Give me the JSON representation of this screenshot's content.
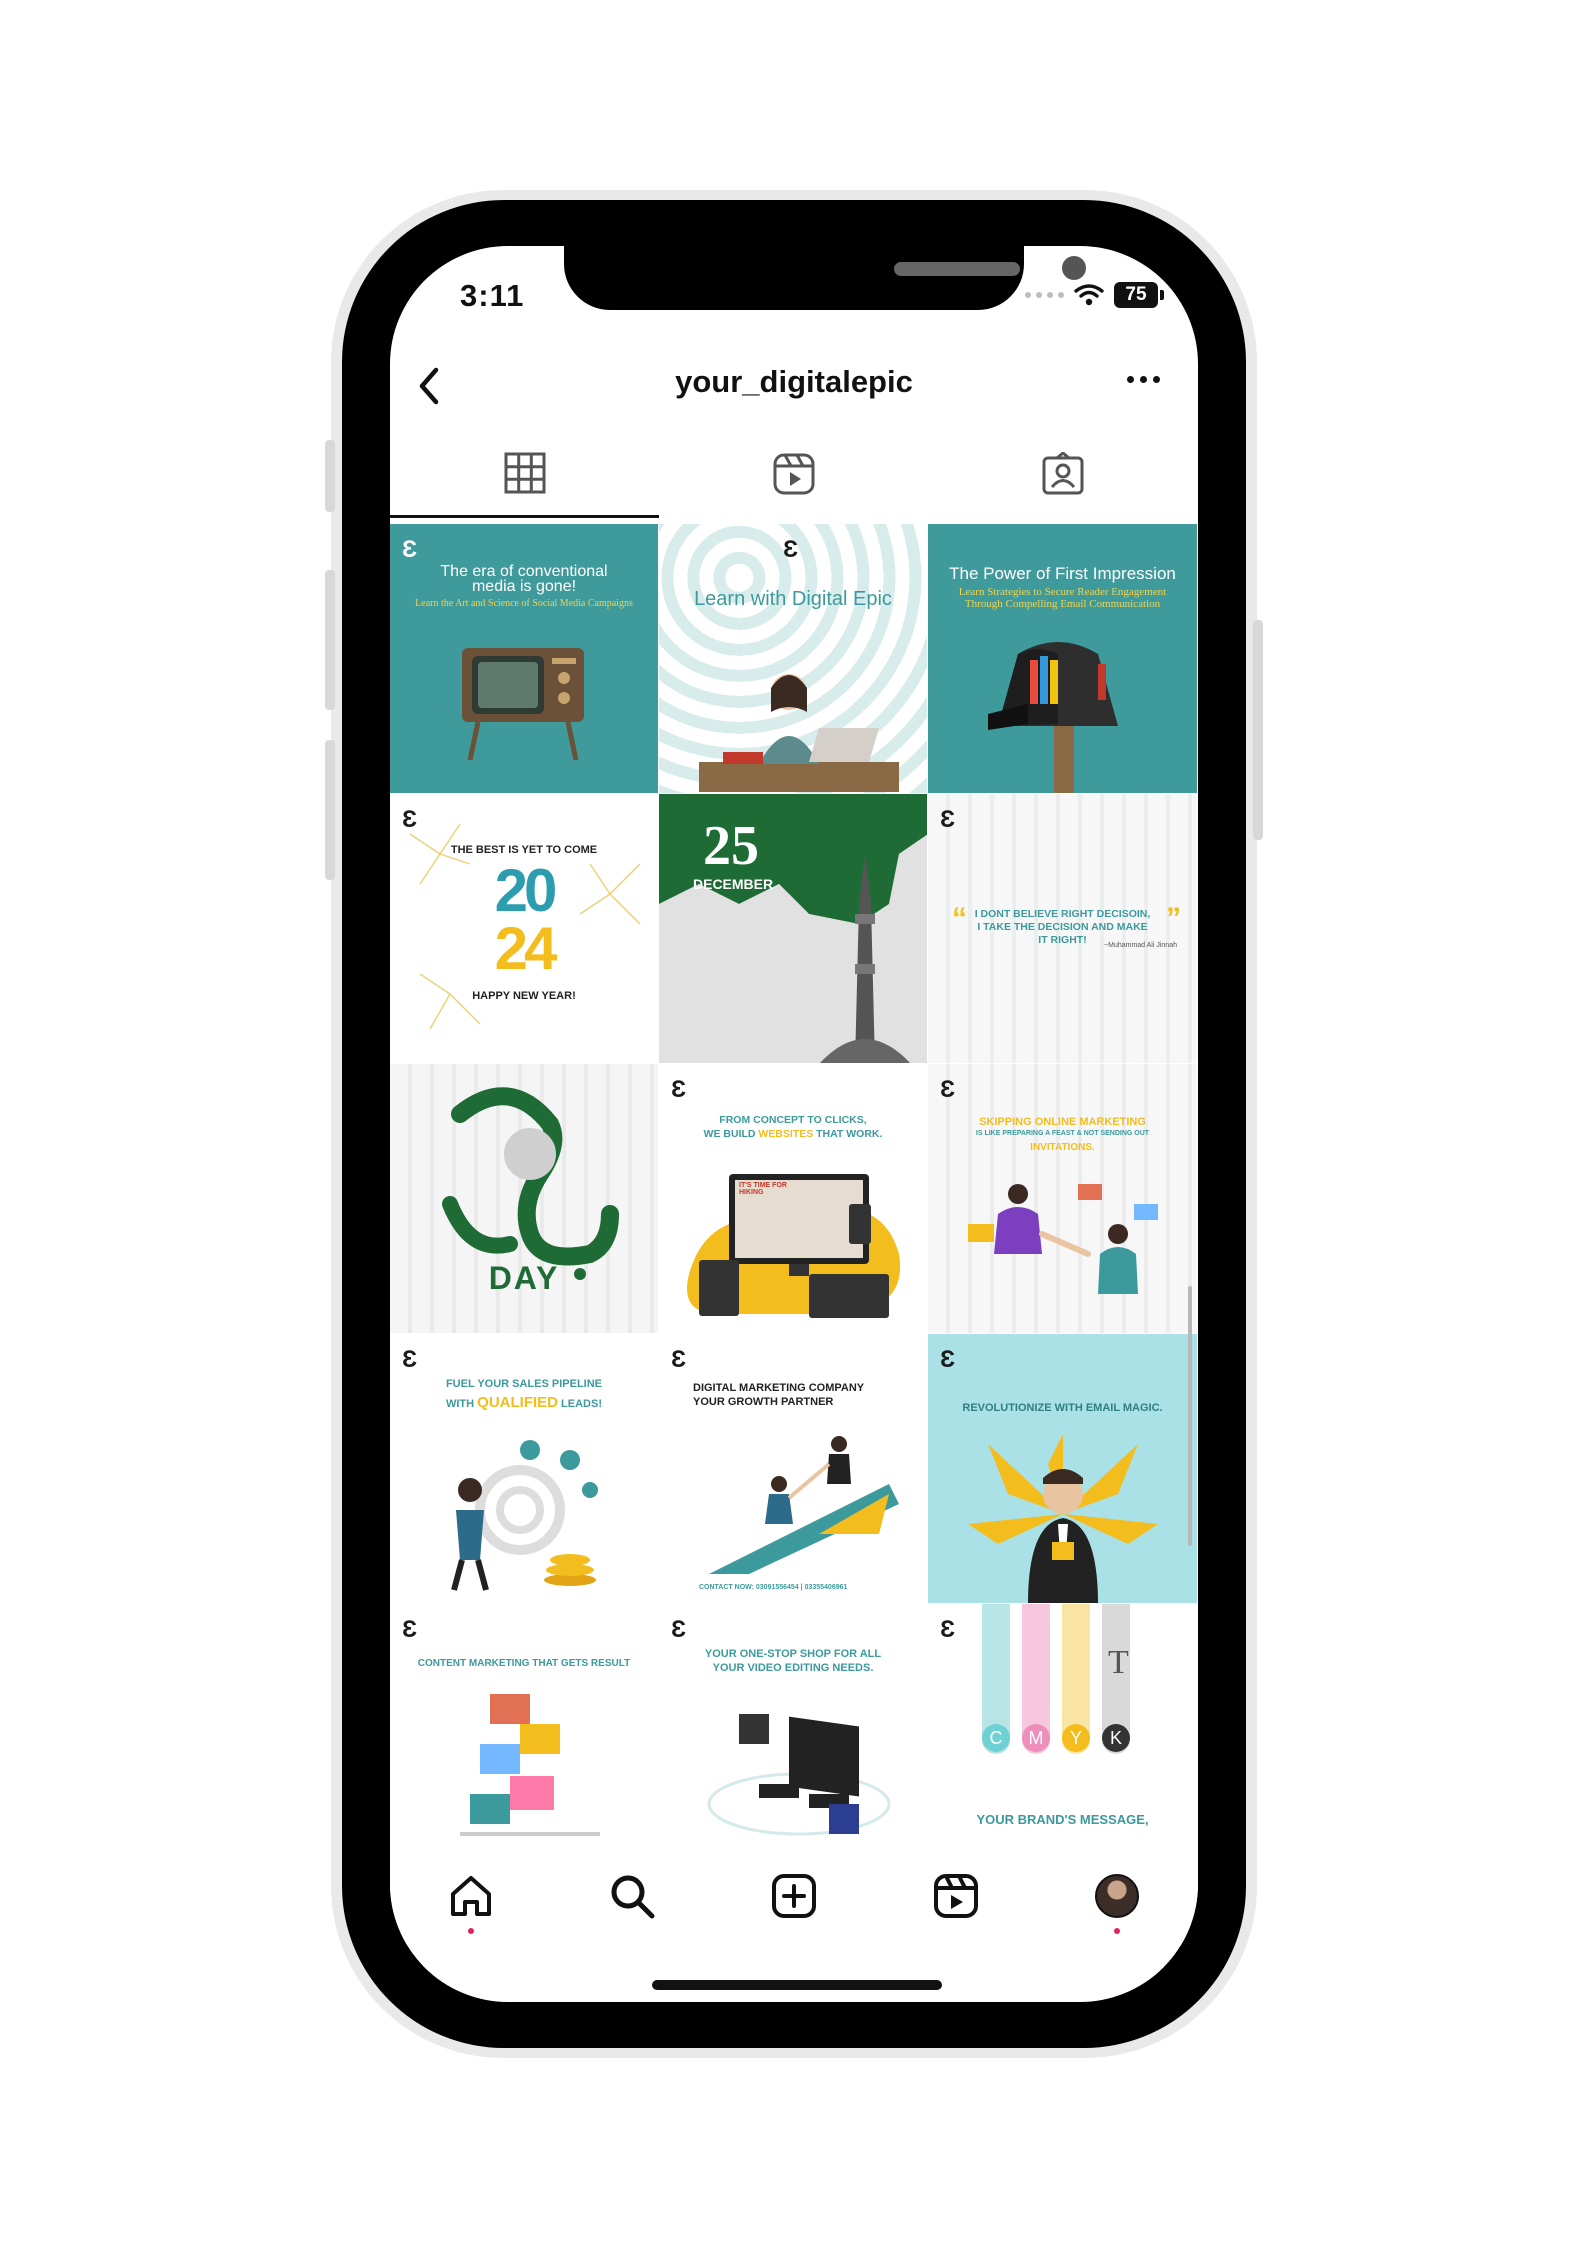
{
  "status_bar": {
    "time": "3:11",
    "battery": "75"
  },
  "profile": {
    "handle": "your_digitalepic"
  },
  "icons": {
    "back": "chevron-left-icon",
    "more": "more-horizontal-icon",
    "grid_tab": "grid-icon",
    "reels_tab": "reels-icon",
    "tagged_tab": "tagged-user-icon",
    "home": "home-icon",
    "search": "search-icon",
    "create": "plus-square-icon",
    "reels": "reels-icon",
    "profile": "avatar-icon"
  },
  "colors": {
    "teal": "#3c9a9c",
    "green": "#1f6b36",
    "gold": "#f2bd1d",
    "accent_red": "#e0245e"
  },
  "posts": [
    {
      "title": "The era of conventional media is gone!",
      "subtitle": "Learn the Art and Science of Social Media Campaigns"
    },
    {
      "title": "Learn with Digital Epic"
    },
    {
      "title": "The Power of First Impression",
      "subtitle": "Learn Strategies to Secure Reader Engagement Through Compelling Email Communication"
    },
    {
      "title": "THE BEST IS YET TO COME",
      "year_top": "20",
      "year_bottom": "24",
      "subtitle": "HAPPY NEW YEAR!"
    },
    {
      "title": "25",
      "subtitle": "DECEMBER"
    },
    {
      "title": "I DONT BELIEVE RIGHT DECISOIN, I TAKE THE DECISION AND MAKE IT RIGHT!",
      "subtitle": "~Muhammad Ali Jinnah"
    },
    {
      "title": "DAY"
    },
    {
      "title": "FROM CONCEPT TO CLICKS,",
      "line2_pre": "WE BUILD ",
      "line2_hl": "WEBSITES",
      "line2_post": " THAT WORK.",
      "screen_text": "IT'S TIME FOR HIKING"
    },
    {
      "title": "SKIPPING ONLINE MARKETING",
      "subtitle": "IS LIKE PREPARING A FEAST & NOT SENDING OUT",
      "subtitle2": "INVITATIONS."
    },
    {
      "title": "FUEL YOUR SALES PIPELINE",
      "line2_pre": "WITH ",
      "line2_hl": "QUALIFIED",
      "line2_post": " LEADS!"
    },
    {
      "title": "DIGITAL MARKETING COMPANY",
      "subtitle": "YOUR GROWTH PARTNER",
      "contact": "CONTACT NOW: 03091556454 | 03355406961"
    },
    {
      "title": "REVOLUTIONIZE WITH EMAIL MAGIC."
    },
    {
      "title": "CONTENT MARKETING THAT GETS RESULT"
    },
    {
      "title": "YOUR ONE-STOP SHOP FOR ALL",
      "subtitle": "YOUR VIDEO EDITING NEEDS."
    },
    {
      "title": "YOUR BRAND'S MESSAGE,",
      "letters": [
        "C",
        "M",
        "Y",
        "K"
      ],
      "tool_letter": "T"
    }
  ]
}
